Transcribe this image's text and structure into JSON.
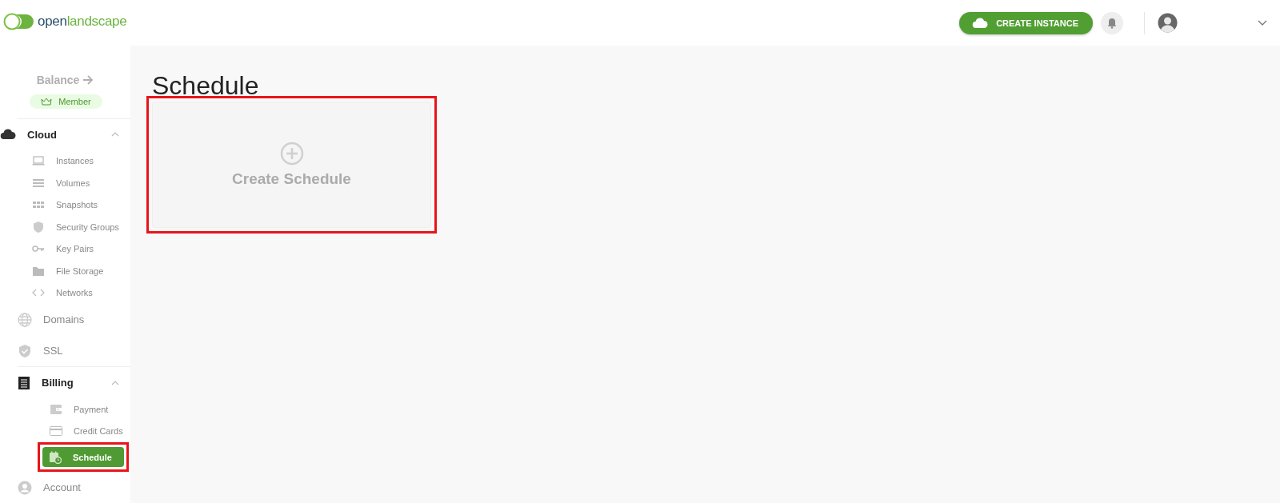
{
  "logo": {
    "dark": "open",
    "green": "landscape"
  },
  "balance": {
    "label": "Balance",
    "badge": "Member"
  },
  "nav": [
    {
      "label": "Cloud",
      "expanded": true,
      "children": [
        {
          "label": "Instances",
          "selected": false,
          "highlighted": false
        },
        {
          "label": "Volumes",
          "selected": false,
          "highlighted": false
        },
        {
          "label": "Snapshots",
          "selected": false,
          "highlighted": false
        },
        {
          "label": "Security Groups",
          "selected": false,
          "highlighted": false
        },
        {
          "label": "Key Pairs",
          "selected": false,
          "highlighted": false
        },
        {
          "label": "File Storage",
          "selected": false,
          "highlighted": false
        },
        {
          "label": "Networks",
          "selected": false,
          "highlighted": false
        }
      ]
    },
    {
      "label": "Domains"
    },
    {
      "label": "SSL"
    },
    {
      "label": "Billing",
      "expanded": true,
      "children": [
        {
          "label": "Payment",
          "selected": false,
          "highlighted": false
        },
        {
          "label": "Credit Cards",
          "selected": false,
          "highlighted": false
        },
        {
          "label": "Schedule",
          "selected": true,
          "highlighted": true
        }
      ]
    },
    {
      "label": "Account"
    }
  ],
  "header": {
    "create_button": "CREATE INSTANCE"
  },
  "page": {
    "title": "Schedule",
    "card": {
      "label": "Create Schedule",
      "highlighted": true
    }
  }
}
